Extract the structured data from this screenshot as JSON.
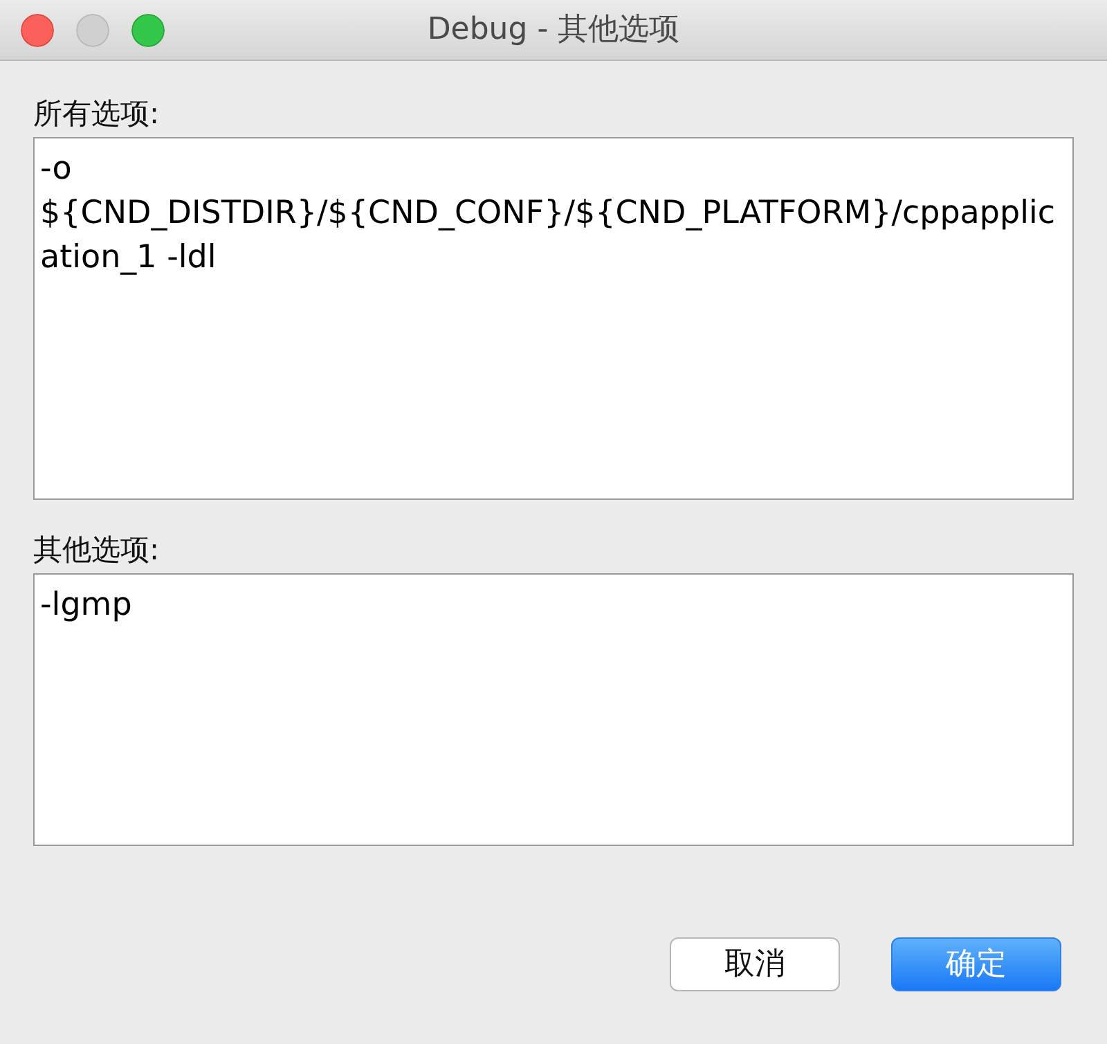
{
  "window": {
    "title": "Debug - 其他选项"
  },
  "all_options": {
    "label": "所有选项:",
    "value": "-o ${CND_DISTDIR}/${CND_CONF}/${CND_PLATFORM}/cppapplication_1 -ldl"
  },
  "other_options": {
    "label": "其他选项:",
    "value": "-lgmp"
  },
  "buttons": [
    {
      "label": "取消",
      "kind": "default"
    },
    {
      "label": "确定",
      "kind": "primary"
    }
  ]
}
